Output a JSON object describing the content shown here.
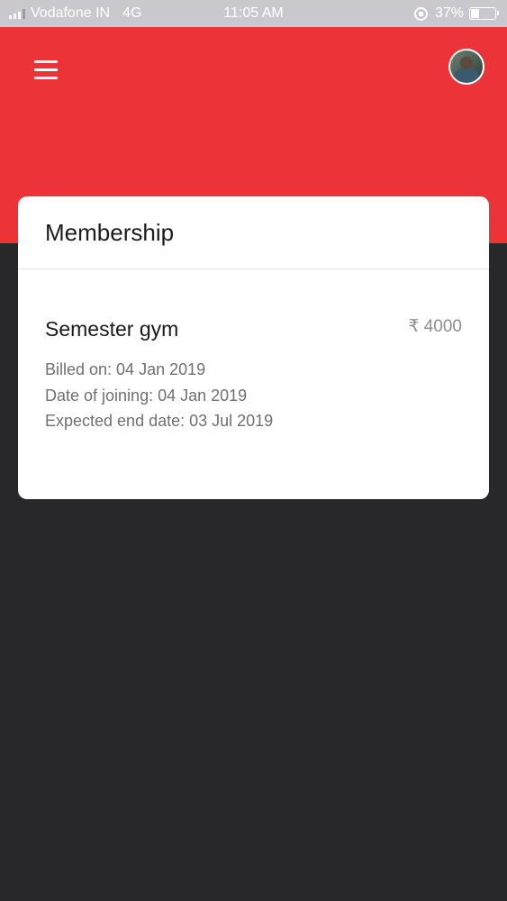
{
  "status_bar": {
    "carrier": "Vodafone IN",
    "network": "4G",
    "time": "11:05 AM",
    "battery": "37%",
    "battery_level": 0.37,
    "signal_bars_filled": 3,
    "signal_bars_total": 4
  },
  "header": {
    "menu_icon": "hamburger-menu-icon",
    "avatar": "user-avatar",
    "color": "#ec3338"
  },
  "membership": {
    "title": "Membership",
    "plan": {
      "name": "Semester gym",
      "price": "₹ 4000",
      "billed_on": "Billed on: 04 Jan 2019",
      "joining_date": "Date of joining: 04 Jan 2019",
      "end_date": "Expected end date: 03 Jul 2019"
    }
  }
}
